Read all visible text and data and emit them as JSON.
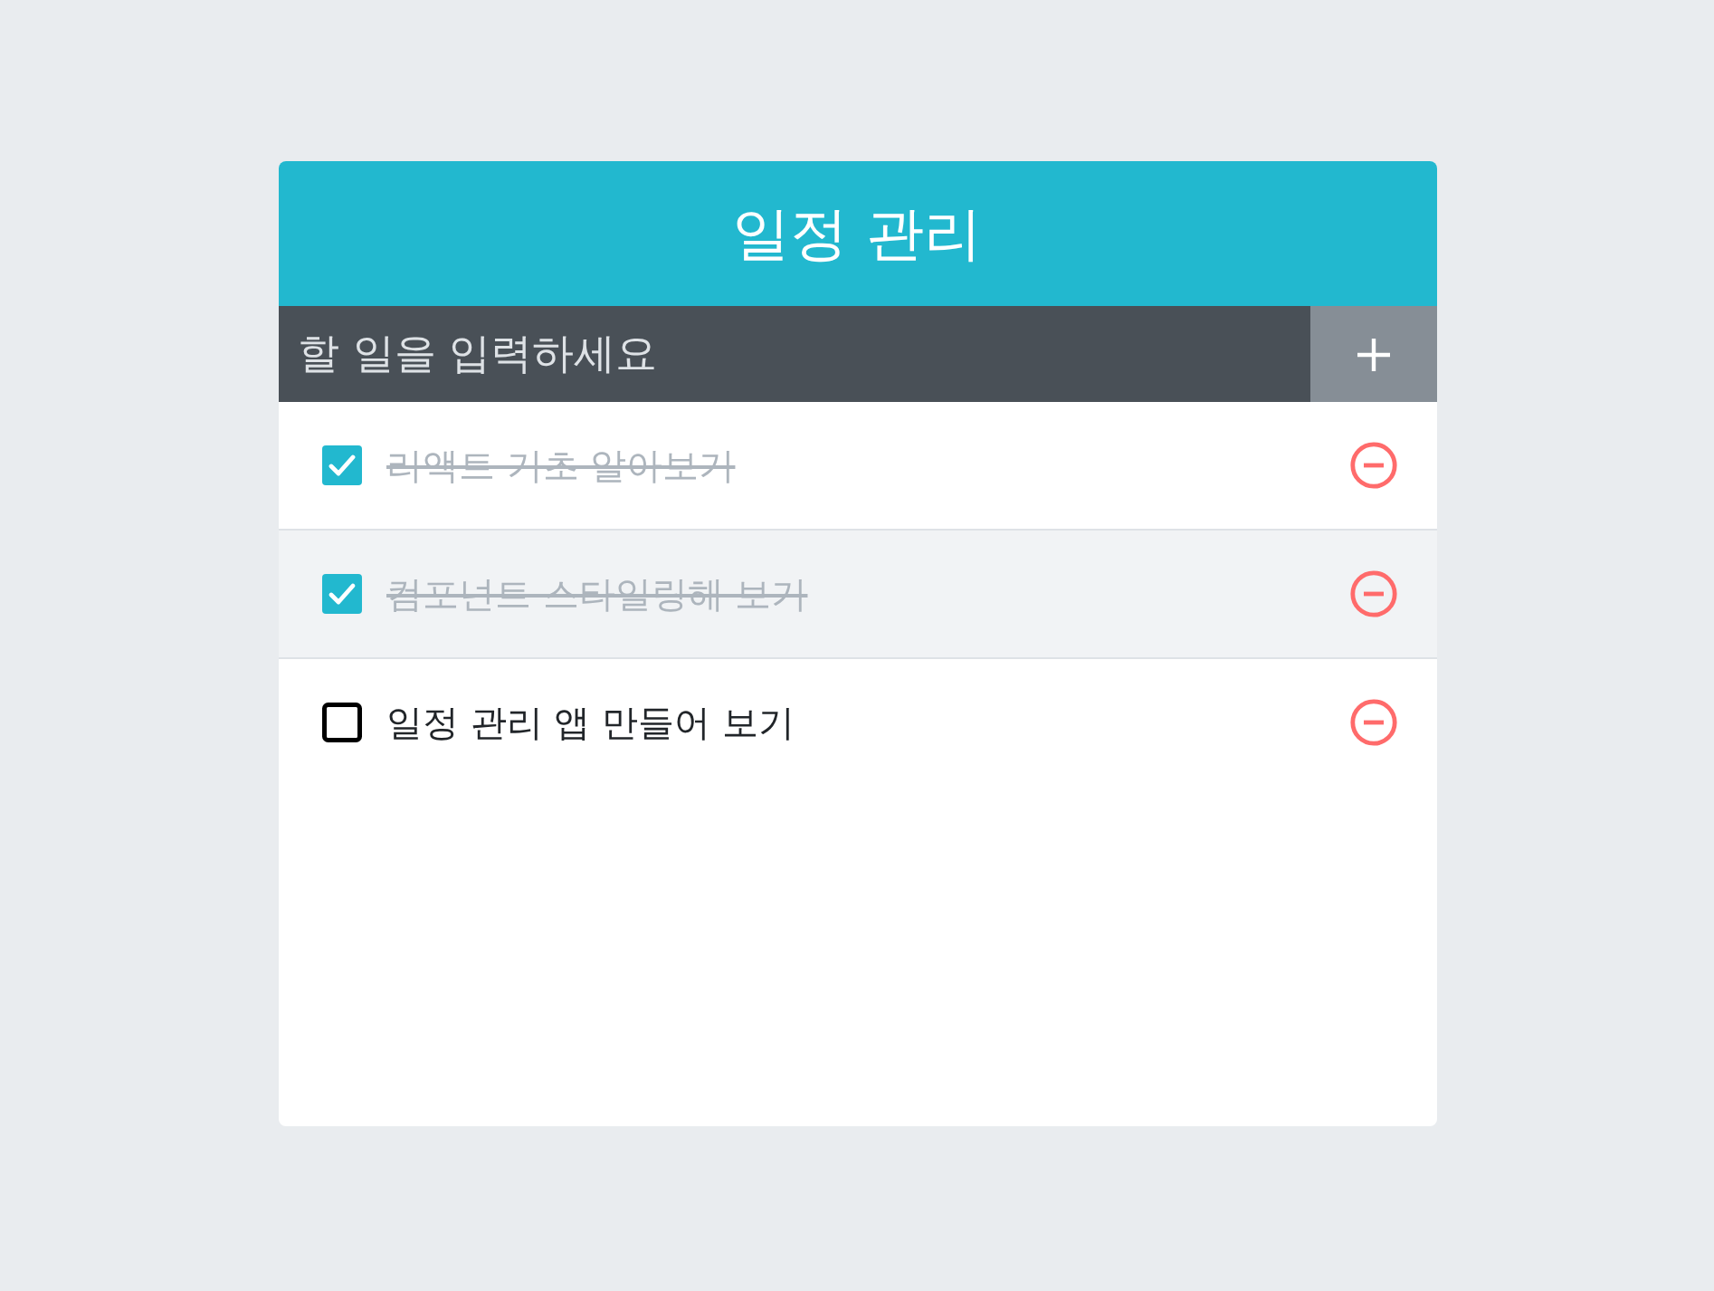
{
  "header": {
    "title": "일정 관리"
  },
  "input": {
    "placeholder": "할 일을 입력하세요"
  },
  "items": [
    {
      "text": "리액트 기초 알아보기",
      "checked": true,
      "hovered": false
    },
    {
      "text": "컴포넌트 스타일링해 보기",
      "checked": true,
      "hovered": true
    },
    {
      "text": "일정 관리 앱 만들어 보기",
      "checked": false,
      "hovered": false
    }
  ]
}
